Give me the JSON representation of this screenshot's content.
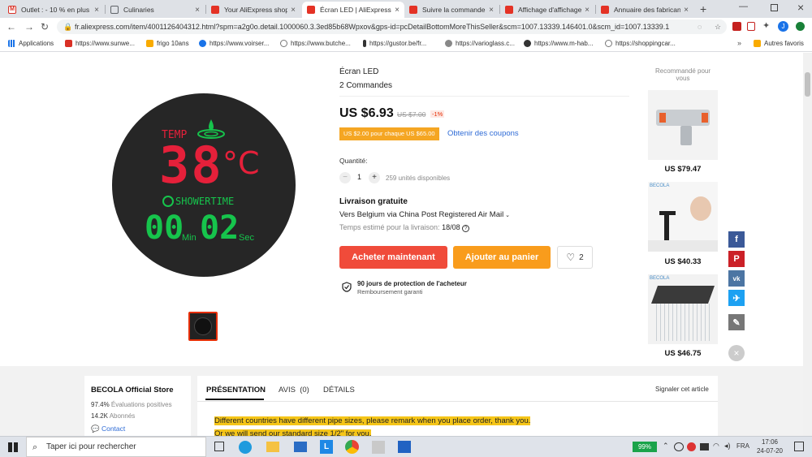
{
  "tabs": [
    {
      "title": "Outlet : - 10 % en plus",
      "icon": "gmail-icon",
      "color": "#d93025"
    },
    {
      "title": "Culinaries",
      "icon": "page-icon",
      "color": "#5f6368"
    },
    {
      "title": "Your AliExpress shopp",
      "icon": "aliexpress-icon",
      "color": "#e43225"
    },
    {
      "title": "Écran LED | AliExpress",
      "icon": "aliexpress-icon",
      "color": "#e43225",
      "active": true
    },
    {
      "title": "Suivre la commande",
      "icon": "aliexpress-icon",
      "color": "#e43225"
    },
    {
      "title": "Affichage d'affichage d",
      "icon": "aliexpress-icon",
      "color": "#e43225"
    },
    {
      "title": "Annuaire des fabricant",
      "icon": "aliexpress-icon",
      "color": "#e43225"
    }
  ],
  "address": "fr.aliexpress.com/item/4001126404312.html?spm=a2g0o.detail.1000060.3.3ed85b68Wpxov&gps-id=pcDetailBottomMoreThisSeller&scm=1007.13339.146401.0&scm_id=1007.13339.1",
  "bookmarks": [
    "Applications",
    "https://www.sunwe...",
    "frigo 10ans",
    "https://www.voirser...",
    "https://www.butche...",
    "https://gustor.be/fr...",
    "https://varioglass.c...",
    "https://www.m-hab...",
    "https://shoppingcar..."
  ],
  "bookmarks_other": "Autres favoris",
  "display": {
    "temp_label": "TEMP",
    "temp_value": "38",
    "temp_unit": "°C",
    "shower_label": "SHOWERTIME",
    "minutes": "00",
    "min_label": "Min",
    "seconds": "02",
    "sec_label": "Sec"
  },
  "product": {
    "title": "Écran LED",
    "orders": "2 Commandes",
    "price": "US $6.93",
    "old_price": "US $7.00",
    "discount": "-1%",
    "coupon": "US $2.00 pour chaque US $65.00",
    "coupon_link": "Obtenir des coupons",
    "qty_label": "Quantité:",
    "qty_minus": "−",
    "qty_value": "1",
    "qty_plus": "+",
    "stock": "259 unités disponibles",
    "shipping_title": "Livraison gratuite",
    "shipping_to": "Vers Belgium via China Post Registered Air Mail",
    "delivery_label": "Temps estimé pour la livraison:",
    "delivery_date": "18/08",
    "buy": "Acheter maintenant",
    "cart": "Ajouter au panier",
    "wishlist_count": "2",
    "protection_title": "90 jours de protection de l'acheteur",
    "protection_sub": "Remboursement garanti"
  },
  "recommended": {
    "title": "Recommandé pour vous",
    "brand": "BECOLA",
    "items": [
      {
        "price": "US $79.47"
      },
      {
        "price": "US $40.33"
      },
      {
        "price": "US $46.75"
      }
    ]
  },
  "store": {
    "name": "BECOLA Official Store",
    "positive": "97.4%",
    "positive_label": "Évaluations positives",
    "followers": "14.2K",
    "followers_label": "Abonnés",
    "contact": "Contact"
  },
  "tabs_detail": {
    "presentation": "PRÉSENTATION",
    "reviews": "AVIS  (0)",
    "details": "DÉTAILS",
    "report": "Signaler cet article"
  },
  "description": [
    "Different countries have different pipe sizes, please remark when you place order, thank you.",
    "Or we will send our standard size 1/2\" for you."
  ],
  "taskbar": {
    "search": "Taper ici pour rechercher",
    "battery": "99%",
    "lang": "FRA",
    "time": "17:06",
    "date": "24-07-20"
  }
}
